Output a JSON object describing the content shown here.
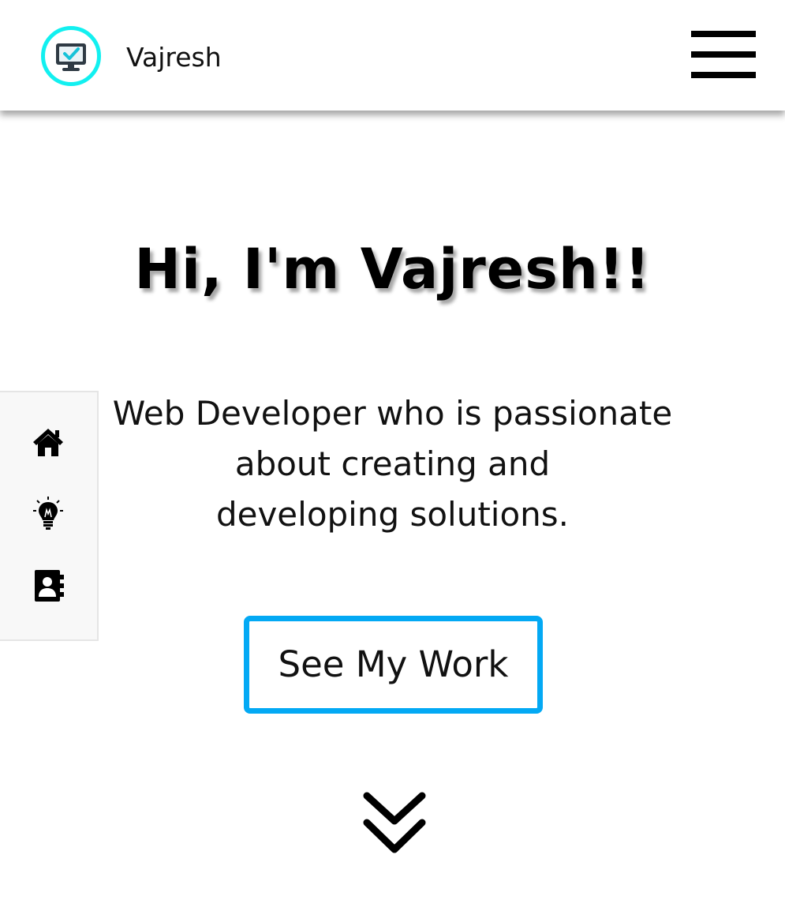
{
  "header": {
    "brand": "Vajresh",
    "logo_icon": "monitor-check-icon",
    "menu_icon": "hamburger-menu-icon",
    "logo_ring_color": "#12f0f0"
  },
  "hero": {
    "title": "Hi, I'm Vajresh!!",
    "subtitle_lines": [
      "Web Developer who is passionate",
      "about creating and",
      "developing solutions."
    ],
    "cta_label": "See My Work",
    "cta_border_color": "#03a9f4",
    "scroll_icon": "double-chevron-down-icon"
  },
  "side_nav": {
    "items": [
      {
        "icon": "home-icon"
      },
      {
        "icon": "lightbulb-icon"
      },
      {
        "icon": "contact-book-icon"
      }
    ]
  }
}
